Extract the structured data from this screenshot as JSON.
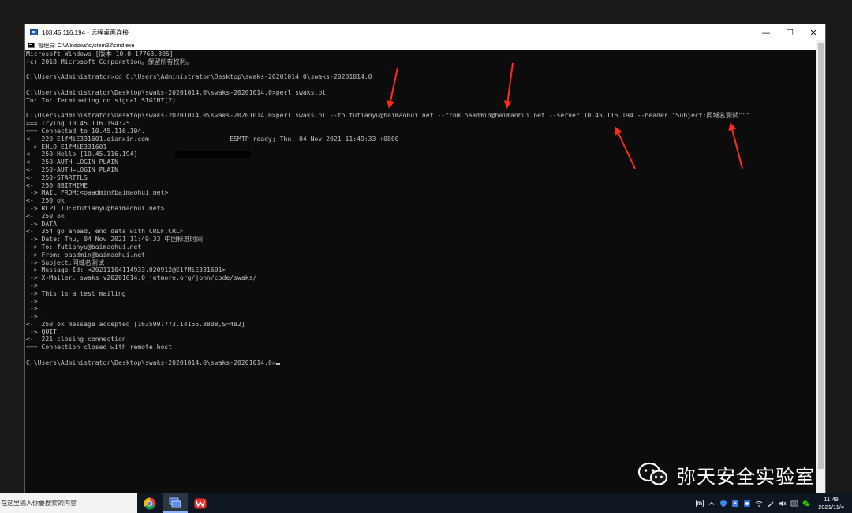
{
  "rdp": {
    "title": "103.45.116.194 - 远程桌面连接"
  },
  "cmd": {
    "title": "管理员: C:\\Windows\\system32\\cmd.exe"
  },
  "console_lines": [
    "Microsoft Windows [版本 10.0.17763.805]",
    "(c) 2018 Microsoft Corporation。保留所有权利。",
    "",
    "C:\\Users\\Administrator>cd C:\\Users\\Administrator\\Desktop\\swaks-20201014.0\\swaks-20201014.0",
    "",
    "C:\\Users\\Administrator\\Desktop\\swaks-20201014.0\\swaks-20201014.0>perl swaks.pl",
    "To: To: Terminating on signal SIGINT(2)",
    "",
    "C:\\Users\\Administrator\\Desktop\\swaks-20201014.0\\swaks-20201014.0>perl swaks.pl --to futianyu@baimaohui.net --from oaadmin@baimaohui.net --server 10.45.116.194 --header \"Subject:同域名测试\"\"\"",
    "=== Trying 10.45.116.194:25...",
    "=== Connected to 10.45.116.194.",
    "<-  220 E1fMiE331601.qianxin.com                     ESMTP ready; Thu, 04 Nov 2021 11:49:33 +0800",
    " -> EHLO E1fMiE331601",
    "<-  250-Hello [10.45.116.194]",
    "<-  250-AUTH LOGIN PLAIN",
    "<-  250-AUTH=LOGIN PLAIN",
    "<-  250-STARTTLS",
    "<-  250 8BITMIME",
    " -> MAIL FROM:<oaadmin@baimaohui.net>",
    "<-  250 ok",
    " -> RCPT TO:<futianyu@baimaohui.net>",
    "<-  250 ok",
    " -> DATA",
    "<-  354 go ahead, end data with CRLF.CRLF",
    " -> Date: Thu, 04 Nov 2021 11:49:33 中国标准时间",
    " -> To: futianyu@baimaohui.net",
    " -> From: oaadmin@baimaohui.net",
    " -> Subject:同域名测试",
    " -> Message-Id: <20211104114933.020912@E1fMiE331601>",
    " -> X-Mailer: swaks v20201014.0 jetmore.org/john/code/swaks/",
    " ->",
    " -> This is a test mailing",
    " ->",
    " ->",
    " -> .",
    "<-  250 ok message accepted [1635997773.14165.8808,S=482]",
    " -> QUIT",
    "<-  221 closing connection",
    "=== Connection closed with remote host.",
    "",
    "C:\\Users\\Administrator\\Desktop\\swaks-20201014.0\\swaks-20201014.0>"
  ],
  "window_controls": {
    "minimize": "—",
    "maximize": "☐",
    "close": "✕"
  },
  "watermark": {
    "text": "弥天安全实验室"
  },
  "taskbar": {
    "search_placeholder": "在这里输入你要搜索的内容",
    "clock_time": "11:49",
    "clock_date": "2021/11/4",
    "tray_icons": [
      "mi-icon",
      "chevron-up-icon",
      "shield-icon",
      "network-icon",
      "app-icon",
      "wifi-icon",
      "ink-icon",
      "volume-icon",
      "ime-icon",
      "wechat-icon"
    ]
  },
  "colors": {
    "console_bg": "#0c0c0c",
    "console_fg": "#c0c0c0",
    "annotation_red": "#ff2a1a",
    "taskbar_bg": "#0e1621"
  }
}
